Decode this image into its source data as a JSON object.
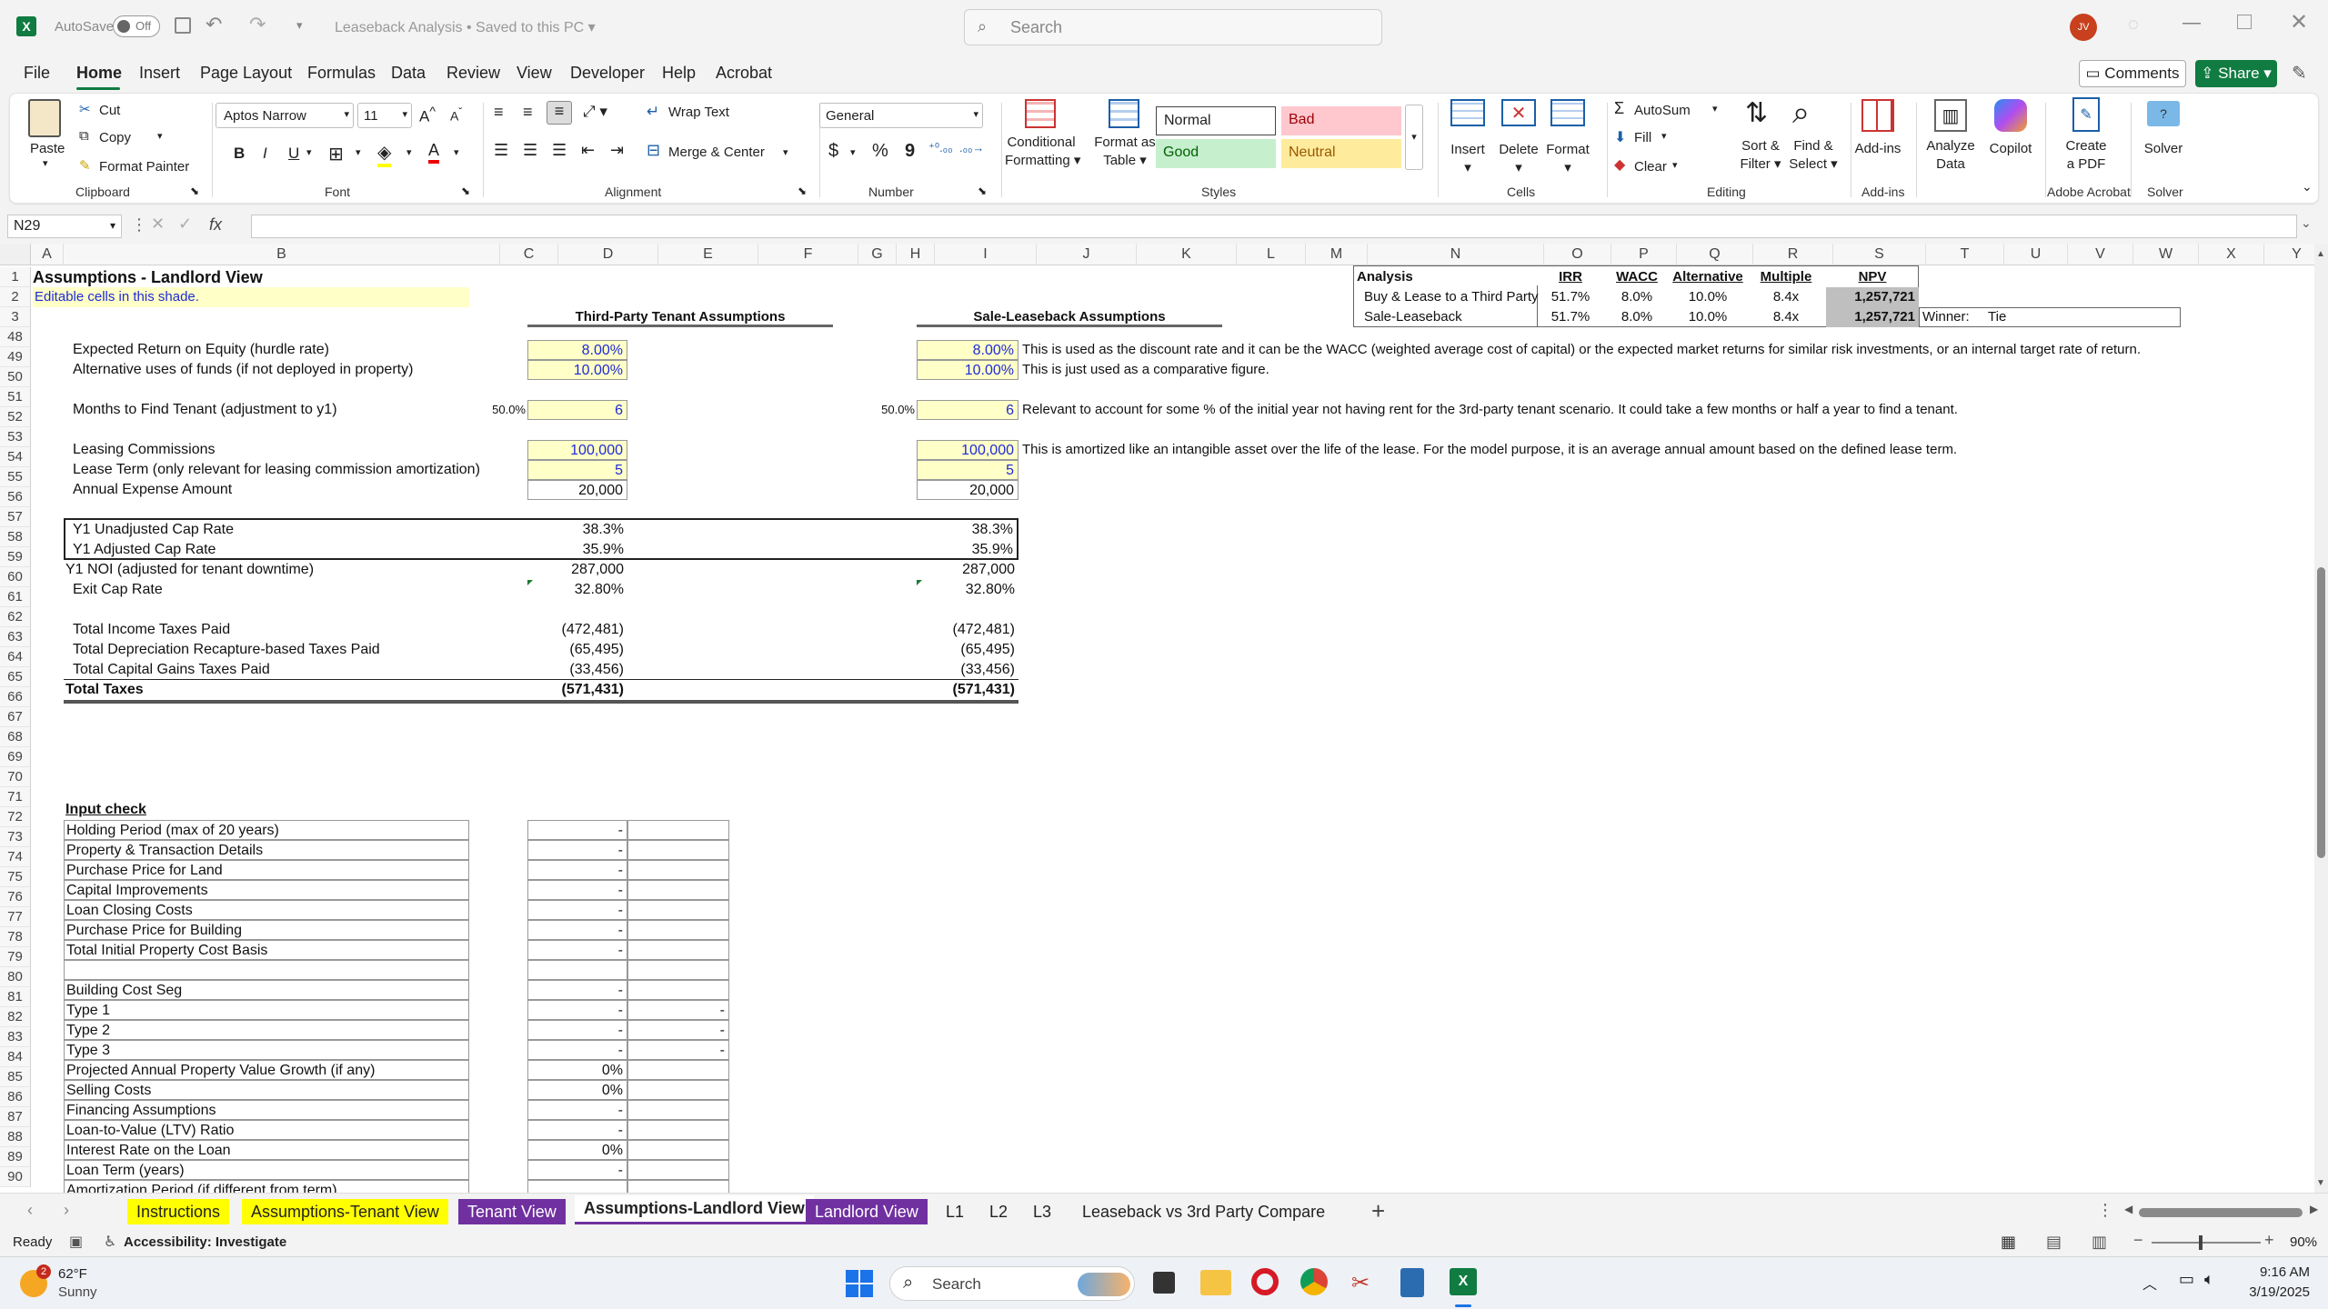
{
  "window": {
    "autosave_label": "AutoSave",
    "autosave_state": "Off",
    "title": "Leaseback Analysis • Saved to this PC",
    "search_placeholder": "Search",
    "user_initials": "JV"
  },
  "menu": {
    "items": [
      "File",
      "Home",
      "Insert",
      "Page Layout",
      "Formulas",
      "Data",
      "Review",
      "View",
      "Developer",
      "Help",
      "Acrobat"
    ],
    "active": "Home",
    "comments": "Comments",
    "share": "Share"
  },
  "ribbon": {
    "clipboard": {
      "paste": "Paste",
      "cut": "Cut",
      "copy": "Copy",
      "format_painter": "Format Painter",
      "group": "Clipboard"
    },
    "font": {
      "name": "Aptos Narrow",
      "size": "11",
      "group": "Font",
      "bold": "B",
      "italic": "I",
      "underline": "U"
    },
    "alignment": {
      "wrap": "Wrap Text",
      "merge": "Merge & Center",
      "group": "Alignment"
    },
    "number": {
      "format": "General",
      "group": "Number",
      "currency": "$",
      "percent": "%",
      "comma": "9"
    },
    "styles": {
      "conditional": "Conditional",
      "conditional2": "Formatting",
      "format_table": "Format as",
      "format_table2": "Table",
      "normal": "Normal",
      "bad": "Bad",
      "good": "Good",
      "neutral": "Neutral",
      "group": "Styles"
    },
    "cells": {
      "insert": "Insert",
      "delete": "Delete",
      "format": "Format",
      "group": "Cells"
    },
    "editing": {
      "autosum": "AutoSum",
      "fill": "Fill",
      "clear": "Clear",
      "sort": "Sort &",
      "sort2": "Filter",
      "find": "Find &",
      "find2": "Select",
      "group": "Editing"
    },
    "addins": {
      "addins": "Add-ins",
      "analyze": "Analyze",
      "analyze2": "Data",
      "copilot": "Copilot",
      "group": "Add-ins"
    },
    "acrobat": {
      "create": "Create",
      "create2": "a PDF",
      "group": "Adobe Acrobat"
    },
    "solver": {
      "solver": "Solver",
      "group": "Solver"
    }
  },
  "formula": {
    "name_box": "N29",
    "fx": "fx",
    "value": ""
  },
  "columns": [
    "A",
    "B",
    "C",
    "D",
    "E",
    "F",
    "G",
    "H",
    "I",
    "J",
    "K",
    "L",
    "M",
    "N",
    "O",
    "P",
    "Q",
    "R",
    "S",
    "T",
    "U",
    "V",
    "W",
    "X",
    "Y"
  ],
  "rows": [
    "1",
    "2",
    "3",
    "48",
    "49",
    "50",
    "51",
    "52",
    "53",
    "54",
    "55",
    "56",
    "57",
    "58",
    "59",
    "60",
    "61",
    "62",
    "63",
    "64",
    "65",
    "66",
    "67",
    "68",
    "69",
    "70",
    "71",
    "72",
    "73",
    "74",
    "75",
    "76",
    "77",
    "78",
    "79",
    "80",
    "81",
    "82",
    "83",
    "84",
    "85",
    "86",
    "87",
    "88",
    "89",
    "90"
  ],
  "sheet": {
    "title": "Assumptions - Landlord View",
    "editable_note": "Editable cells in this shade.",
    "third_party_header": "Third-Party Tenant Assumptions",
    "sale_leaseback_header": "Sale-Leaseback Assumptions",
    "analysis": {
      "label": "Analysis",
      "headers": [
        "IRR",
        "WACC",
        "Alternative",
        "Multiple",
        "NPV"
      ],
      "rows": [
        {
          "label": "Buy & Lease to a Third Party",
          "values": [
            "51.7%",
            "8.0%",
            "10.0%",
            "8.4x",
            "1,257,721"
          ]
        },
        {
          "label": "Sale-Leaseback",
          "values": [
            "51.7%",
            "8.0%",
            "10.0%",
            "8.4x",
            "1,257,721"
          ]
        }
      ],
      "winner_label": "Winner:",
      "winner_value": "Tie"
    },
    "r48": {
      "label": "Expected Return on Equity (hurdle rate)",
      "d": "8.00%",
      "i": "8.00%",
      "note": "This is used as the discount rate and it can be the WACC (weighted average cost of capital) or the expected market returns for similar risk investments, or an internal target rate of return."
    },
    "r49": {
      "label": "Alternative uses of funds (if not deployed in property)",
      "d": "10.00%",
      "i": "10.00%",
      "note": "This is just used as a comparative figure."
    },
    "r51": {
      "label": "Months to Find Tenant (adjustment to y1)",
      "c": "50.0%",
      "d": "6",
      "h": "50.0%",
      "i": "6",
      "note": "Relevant to account for some % of the initial year not having rent for the 3rd-party tenant scenario. It could take a few months or half a year to find a tenant."
    },
    "r53": {
      "label": "Leasing Commissions",
      "d": "100,000",
      "i": "100,000",
      "note": "This is amortized like an intangible asset over the life of the lease. For the model purpose, it is an average annual amount based on the defined lease term."
    },
    "r54": {
      "label": "Lease Term (only relevant for leasing commission amortization)",
      "d": "5",
      "i": "5"
    },
    "r55": {
      "label": "Annual Expense Amount",
      "d": "20,000",
      "i": "20,000"
    },
    "r57": {
      "label": "Y1 Unadjusted Cap Rate",
      "d": "38.3%",
      "i": "38.3%"
    },
    "r58": {
      "label": "Y1 Adjusted Cap Rate",
      "d": "35.9%",
      "i": "35.9%"
    },
    "r59": {
      "label": "Y1 NOI (adjusted for tenant downtime)",
      "d": "287,000",
      "i": "287,000"
    },
    "r60": {
      "label": "Exit Cap Rate",
      "d": "32.80%",
      "i": "32.80%"
    },
    "r62": {
      "label": "Total Income Taxes Paid",
      "d": "(472,481)",
      "i": "(472,481)"
    },
    "r63": {
      "label": "Total Depreciation Recapture-based Taxes Paid",
      "d": "(65,495)",
      "i": "(65,495)"
    },
    "r64": {
      "label": "Total Capital Gains Taxes Paid",
      "d": "(33,456)",
      "i": "(33,456)"
    },
    "r65": {
      "label": "Total Taxes",
      "d": "(571,431)",
      "i": "(571,431)"
    },
    "input_check": "Input check",
    "checks": [
      {
        "label": "Holding Period (max of 20 years)",
        "d": "-",
        "e": ""
      },
      {
        "label": "Property & Transaction Details",
        "d": "-",
        "e": ""
      },
      {
        "label": "Purchase Price for Land",
        "d": "-",
        "e": ""
      },
      {
        "label": "Capital Improvements",
        "d": "-",
        "e": ""
      },
      {
        "label": "Loan Closing Costs",
        "d": "-",
        "e": ""
      },
      {
        "label": "Purchase Price for Building",
        "d": "-",
        "e": ""
      },
      {
        "label": "Total Initial Property Cost Basis",
        "d": "-",
        "e": ""
      },
      {
        "label": "",
        "d": "",
        "e": ""
      },
      {
        "label": "Building Cost Seg",
        "d": "-",
        "e": ""
      },
      {
        "label": "Type 1",
        "d": "-",
        "e": "-"
      },
      {
        "label": "Type 2",
        "d": "-",
        "e": "-"
      },
      {
        "label": "Type 3",
        "d": "-",
        "e": "-"
      },
      {
        "label": "Projected Annual Property Value Growth (if any)",
        "d": "0%",
        "e": ""
      },
      {
        "label": "Selling Costs",
        "d": "0%",
        "e": ""
      },
      {
        "label": "Financing Assumptions",
        "d": "-",
        "e": ""
      },
      {
        "label": "Loan-to-Value (LTV) Ratio",
        "d": "-",
        "e": ""
      },
      {
        "label": "Interest Rate on the Loan",
        "d": "0%",
        "e": ""
      },
      {
        "label": "Loan Term (years)",
        "d": "-",
        "e": ""
      },
      {
        "label": "Amortization Period (if different from term)",
        "d": "",
        "e": ""
      }
    ]
  },
  "tabs": [
    "Instructions",
    "Assumptions-Tenant View",
    "Tenant View",
    "Assumptions-Landlord View",
    "Landlord View",
    "L1",
    "L2",
    "L3",
    "Leaseback vs 3rd Party Compare"
  ],
  "tab_colors": {
    "yellow": "#ffff00",
    "purple": "#7030a0"
  },
  "status": {
    "ready": "Ready",
    "accessibility": "Accessibility: Investigate",
    "zoom": "90%"
  },
  "taskbar": {
    "weather_temp": "62°F",
    "weather_desc": "Sunny",
    "weather_badge": "2",
    "search": "Search",
    "time": "9:16 AM",
    "date": "3/19/2025"
  }
}
